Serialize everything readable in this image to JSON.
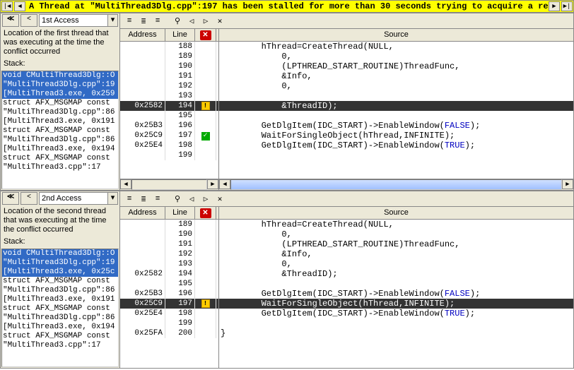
{
  "banner": {
    "message": "A Thread at \"MultiThread3Dlg.cpp\":197 has been stalled for more than 30 seconds trying to acquire a resource owned by..."
  },
  "pane1": {
    "combo_label": "1st Access",
    "desc": "Location of the first thread that was executing at the time the conflict occurred",
    "stack_label": "Stack:",
    "stack": [
      {
        "text": "void CMultiThread3Dlg::O",
        "sel": true
      },
      {
        "text": "\"MultiThread3Dlg.cpp\":19",
        "sel": true
      },
      {
        "text": "[MultiThread3.exe, 0x259",
        "sel": true
      },
      {
        "text": "struct AFX_MSGMAP const",
        "sel": false
      },
      {
        "text": "\"MultiThread3Dlg.cpp\":86",
        "sel": false
      },
      {
        "text": "[MultiThread3.exe, 0x191",
        "sel": false
      },
      {
        "text": "struct AFX_MSGMAP const",
        "sel": false
      },
      {
        "text": "\"MultiThread3Dlg.cpp\":86",
        "sel": false
      },
      {
        "text": "[MultiThread3.exe, 0x194",
        "sel": false
      },
      {
        "text": "struct AFX_MSGMAP const",
        "sel": false
      },
      {
        "text": "\"MultiThread3.cpp\":17",
        "sel": false
      }
    ],
    "rows": [
      {
        "addr": "",
        "line": "188",
        "mark": "",
        "src": "        hThread=CreateThread(NULL,"
      },
      {
        "addr": "",
        "line": "189",
        "mark": "",
        "src": "            0,"
      },
      {
        "addr": "",
        "line": "190",
        "mark": "",
        "src": "            (LPTHREAD_START_ROUTINE)ThreadFunc,"
      },
      {
        "addr": "",
        "line": "191",
        "mark": "",
        "src": "            &Info,"
      },
      {
        "addr": "",
        "line": "192",
        "mark": "",
        "src": "            0,"
      },
      {
        "addr": "",
        "line": "193",
        "mark": "",
        "src": ""
      },
      {
        "addr": "0x2582",
        "line": "194",
        "mark": "warn",
        "hl": true,
        "src": "            &ThreadID);"
      },
      {
        "addr": "",
        "line": "195",
        "mark": "",
        "src": ""
      },
      {
        "addr": "0x25B3",
        "line": "196",
        "mark": "",
        "src": "        GetDlgItem(IDC_START)->EnableWindow(FALSE);",
        "kw": "FALSE"
      },
      {
        "addr": "0x25C9",
        "line": "197",
        "mark": "check",
        "src": "        WaitForSingleObject(hThread,INFINITE);"
      },
      {
        "addr": "0x25E4",
        "line": "198",
        "mark": "",
        "src": "        GetDlgItem(IDC_START)->EnableWindow(TRUE);",
        "kw": "TRUE"
      },
      {
        "addr": "",
        "line": "199",
        "mark": "",
        "src": ""
      }
    ]
  },
  "pane2": {
    "combo_label": "2nd Access",
    "desc": "Location of the second thread that was executing at the time the conflict occurred",
    "stack_label": "Stack:",
    "stack": [
      {
        "text": "void CMultiThread3Dlg::O",
        "sel": true
      },
      {
        "text": "\"MultiThread3Dlg.cpp\":19",
        "sel": true
      },
      {
        "text": "[MultiThread3.exe, 0x25c",
        "sel": true
      },
      {
        "text": "struct AFX_MSGMAP const",
        "sel": false
      },
      {
        "text": "\"MultiThread3Dlg.cpp\":86",
        "sel": false
      },
      {
        "text": "[MultiThread3.exe, 0x191",
        "sel": false
      },
      {
        "text": "struct AFX_MSGMAP const",
        "sel": false
      },
      {
        "text": "\"MultiThread3Dlg.cpp\":86",
        "sel": false
      },
      {
        "text": "[MultiThread3.exe, 0x194",
        "sel": false
      },
      {
        "text": "struct AFX_MSGMAP const",
        "sel": false
      },
      {
        "text": "\"MultiThread3.cpp\":17",
        "sel": false
      }
    ],
    "rows": [
      {
        "addr": "",
        "line": "189",
        "mark": "",
        "src": "        hThread=CreateThread(NULL,"
      },
      {
        "addr": "",
        "line": "190",
        "mark": "",
        "src": "            0,"
      },
      {
        "addr": "",
        "line": "191",
        "mark": "",
        "src": "            (LPTHREAD_START_ROUTINE)ThreadFunc,"
      },
      {
        "addr": "",
        "line": "192",
        "mark": "",
        "src": "            &Info,"
      },
      {
        "addr": "",
        "line": "193",
        "mark": "",
        "src": "            0,"
      },
      {
        "addr": "0x2582",
        "line": "194",
        "mark": "",
        "src": "            &ThreadID);"
      },
      {
        "addr": "",
        "line": "195",
        "mark": "",
        "src": ""
      },
      {
        "addr": "0x25B3",
        "line": "196",
        "mark": "",
        "src": "        GetDlgItem(IDC_START)->EnableWindow(FALSE);",
        "kw": "FALSE"
      },
      {
        "addr": "0x25C9",
        "line": "197",
        "mark": "warn",
        "hl": true,
        "src": "        WaitForSingleObject(hThread,INFINITE);"
      },
      {
        "addr": "0x25E4",
        "line": "198",
        "mark": "",
        "src": "        GetDlgItem(IDC_START)->EnableWindow(TRUE);",
        "kw": "TRUE"
      },
      {
        "addr": "",
        "line": "199",
        "mark": "",
        "src": ""
      },
      {
        "addr": "0x25FA",
        "line": "200",
        "mark": "",
        "src": "}"
      }
    ]
  },
  "headers": {
    "address": "Address",
    "line": "Line",
    "source": "Source"
  },
  "toolbar_icons": [
    "align-left-icon",
    "align-center-icon",
    "align-right-icon",
    "sep",
    "locate-icon",
    "bookmark-prev-icon",
    "bookmark-next-icon",
    "bookmark-clear-icon"
  ]
}
